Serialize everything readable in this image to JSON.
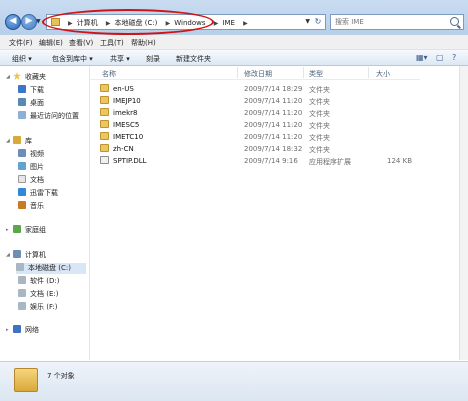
{
  "address": {
    "crumbs": [
      "计算机",
      "本地磁盘 (C:)",
      "Windows",
      "IME"
    ]
  },
  "search": {
    "placeholder": "搜索 IME"
  },
  "menu": [
    "文件(F)",
    "编辑(E)",
    "查看(V)",
    "工具(T)",
    "帮助(H)"
  ],
  "commands": [
    "组织 ▾",
    "包含到库中 ▾",
    "共享 ▾",
    "刻录",
    "新建文件夹"
  ],
  "sidebar": {
    "favorites": {
      "label": "收藏夹",
      "items": [
        "下载",
        "桌面",
        "最近访问的位置"
      ]
    },
    "libraries": {
      "label": "库",
      "items": [
        "视频",
        "图片",
        "文档",
        "迅雷下载",
        "音乐"
      ]
    },
    "homegroup": {
      "label": "家庭组"
    },
    "computer": {
      "label": "计算机",
      "items": [
        "本地磁盘 (C:)",
        "软件 (D:)",
        "文档 (E:)",
        "娱乐 (F:)"
      ]
    },
    "network": {
      "label": "网络"
    }
  },
  "columns": {
    "name": "名称",
    "date": "修改日期",
    "type": "类型",
    "size": "大小"
  },
  "files": [
    {
      "name": "en-US",
      "date": "2009/7/14 18:29",
      "type": "文件夹",
      "size": "",
      "kind": "folder"
    },
    {
      "name": "IMEJP10",
      "date": "2009/7/14 11:20",
      "type": "文件夹",
      "size": "",
      "kind": "folder"
    },
    {
      "name": "imekr8",
      "date": "2009/7/14 11:20",
      "type": "文件夹",
      "size": "",
      "kind": "folder"
    },
    {
      "name": "IMESC5",
      "date": "2009/7/14 11:20",
      "type": "文件夹",
      "size": "",
      "kind": "folder"
    },
    {
      "name": "IMETC10",
      "date": "2009/7/14 11:20",
      "type": "文件夹",
      "size": "",
      "kind": "folder"
    },
    {
      "name": "zh-CN",
      "date": "2009/7/14 18:32",
      "type": "文件夹",
      "size": "",
      "kind": "folder"
    },
    {
      "name": "SPTIP.DLL",
      "date": "2009/7/14 9:16",
      "type": "应用程序扩展",
      "size": "124 KB",
      "kind": "dll"
    }
  ],
  "status": {
    "text": "7 个对象"
  },
  "colors": {
    "highlight": "#d01414",
    "selection": "#d9e6f5",
    "folder": "#ecc65f"
  }
}
